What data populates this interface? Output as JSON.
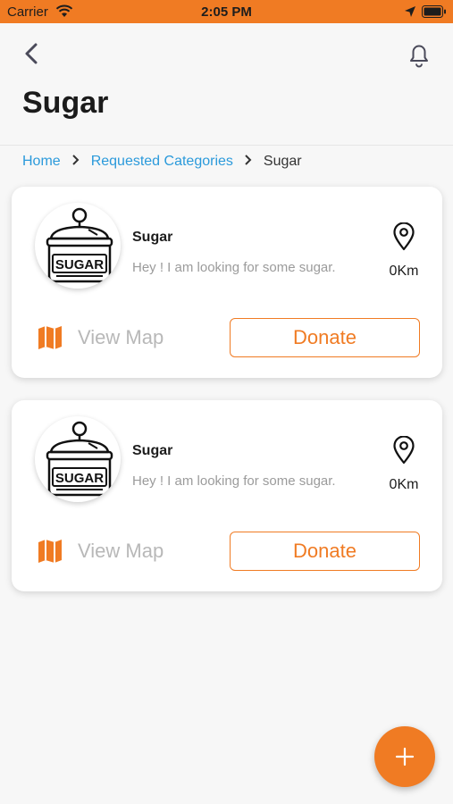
{
  "status_bar": {
    "carrier": "Carrier",
    "time": "2:05 PM"
  },
  "header": {
    "title": "Sugar"
  },
  "breadcrumb": {
    "home": "Home",
    "requested": "Requested Categories",
    "current": "Sugar"
  },
  "colors": {
    "accent": "#f07b23",
    "link": "#2b9adb"
  },
  "requests": [
    {
      "title": "Sugar",
      "message": "Hey ! I am looking for some sugar.",
      "distance": "0Km",
      "view_map": "View Map",
      "donate": "Donate",
      "avatar_text": "SUGAR"
    },
    {
      "title": "Sugar",
      "message": "Hey ! I am looking for some sugar.",
      "distance": "0Km",
      "view_map": "View Map",
      "donate": "Donate",
      "avatar_text": "SUGAR"
    }
  ],
  "fab": {
    "icon": "plus-icon"
  }
}
